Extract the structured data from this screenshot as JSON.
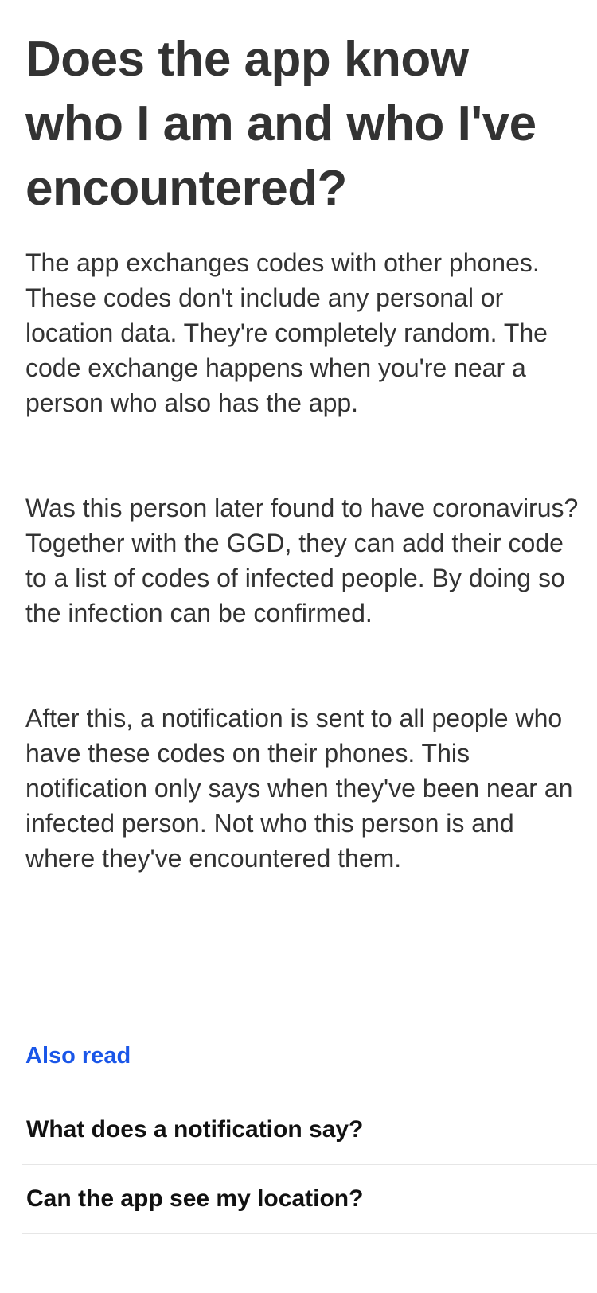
{
  "article": {
    "title": "Does the app know who I am and who I've encountered?",
    "paragraphs": [
      "The app exchanges codes with other phones. These codes don't include any personal or location data. They're completely random. The code exchange happens when you're near a person who also has the app.",
      "Was this person later found to have coronavirus? Together with the GGD, they can add their code to a list of codes of infected people. By doing so the infection can be confirmed.",
      "After this, a notification is sent to all people who have these codes on their phones. This notification only says when they've been near an infected person. Not who this person is and where they've encountered them."
    ]
  },
  "also_read": {
    "heading": "Also read",
    "items": [
      {
        "label": "What does a notification say?"
      },
      {
        "label": "Can the app see my location?"
      }
    ]
  },
  "colors": {
    "accent": "#1a56e8",
    "text": "#333333",
    "divider": "#e6e6e6"
  }
}
